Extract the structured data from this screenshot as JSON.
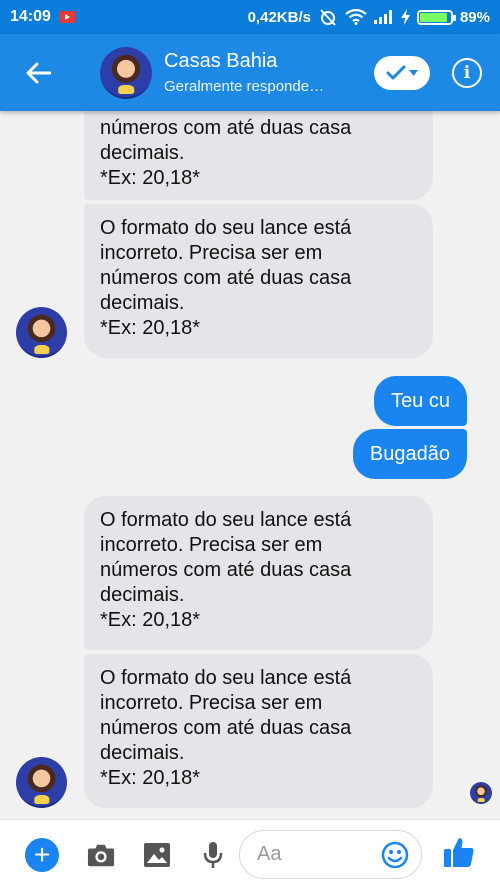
{
  "status_bar": {
    "time": "14:09",
    "notification_icon": "youtube-icon",
    "network_speed": "0,42KB/s",
    "battery_percent": "89%",
    "battery_level": 0.89
  },
  "header": {
    "contact_name": "Casas Bahia",
    "subtitle": "Geralmente responde…",
    "accent_color": "#1e88e5"
  },
  "messages": [
    {
      "direction": "incoming",
      "lines": [
        "números com até duas casa",
        "decimais.",
        "*Ex: 20,18*"
      ]
    },
    {
      "direction": "incoming",
      "lines": [
        "O formato do seu lance está",
        "incorreto. Precisa ser em",
        "números com até duas casa",
        "decimais.",
        "*Ex: 20,18*"
      ]
    },
    {
      "direction": "outgoing",
      "text": "Teu cu"
    },
    {
      "direction": "outgoing",
      "text": "Bugadão"
    },
    {
      "direction": "incoming",
      "lines": [
        "O formato do seu lance está",
        "incorreto. Precisa ser em",
        "números com até duas casa",
        "decimais.",
        "*Ex: 20,18*"
      ]
    },
    {
      "direction": "incoming",
      "lines": [
        "O formato do seu lance está",
        "incorreto. Precisa ser em",
        "números com até duas casa",
        "decimais.",
        "*Ex: 20,18*"
      ]
    }
  ],
  "composer": {
    "placeholder": "Aa",
    "outgoing_color": "#1a85f0"
  }
}
